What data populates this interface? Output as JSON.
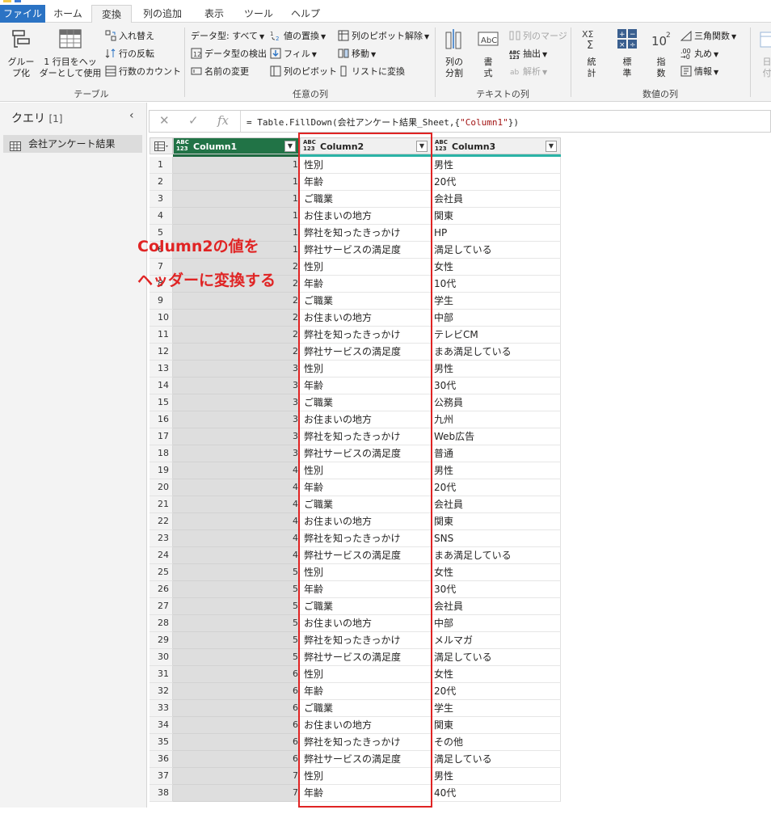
{
  "menu": {
    "tabs": [
      "ファイル",
      "ホーム",
      "変換",
      "列の追加",
      "表示",
      "ツール",
      "ヘルプ"
    ],
    "active_tab": "変換"
  },
  "ribbon": {
    "table": {
      "group_label": "テーブル",
      "group_by": "グルー\nプ化",
      "use_first_row": "1 行目をヘッ\nダーとして使用",
      "transpose": "入れ替え",
      "reverse_rows": "行の反転",
      "count_rows": "行数のカウント"
    },
    "any_column": {
      "group_label": "任意の列",
      "data_type": "データ型: すべて",
      "detect_type": "データ型の検出",
      "rename": "名前の変更",
      "replace_values": "値の置換",
      "fill": "フィル",
      "pivot": "列のピボット",
      "unpivot": "列のピボット解除",
      "move": "移動",
      "to_list": "リストに変換"
    },
    "text_column": {
      "group_label": "テキストの列",
      "split": "列の\n分割",
      "format": "書\n式",
      "merge": "列のマージ",
      "extract": "抽出",
      "parse": "解析"
    },
    "number_column": {
      "group_label": "数値の列",
      "statistics": "統\n計",
      "standard": "標\n準",
      "scientific": "指\n数",
      "trig": "三角関数",
      "rounding": "丸め",
      "information": "情報",
      "date_partial": "日\n付"
    }
  },
  "queries": {
    "title": "クエリ",
    "count": "[1]",
    "items": [
      "会社アンケート結果"
    ]
  },
  "formula": {
    "prefix": "= Table.FillDown(会社アンケート結果_Sheet,{",
    "string": "\"Column1\"",
    "suffix": "})"
  },
  "grid": {
    "columns": [
      {
        "type": "ABC\n123",
        "name": "Column1"
      },
      {
        "type": "ABC\n123",
        "name": "Column2"
      },
      {
        "type": "ABC\n123",
        "name": "Column3"
      }
    ],
    "rows": [
      {
        "n": "1",
        "c1": "1",
        "c2": "性別",
        "c3": "男性"
      },
      {
        "n": "2",
        "c1": "1",
        "c2": "年齢",
        "c3": "20代"
      },
      {
        "n": "3",
        "c1": "1",
        "c2": "ご職業",
        "c3": "会社員"
      },
      {
        "n": "4",
        "c1": "1",
        "c2": "お住まいの地方",
        "c3": "関東"
      },
      {
        "n": "5",
        "c1": "1",
        "c2": "弊社を知ったきっかけ",
        "c3": "HP"
      },
      {
        "n": "6",
        "c1": "1",
        "c2": "弊社サービスの満足度",
        "c3": "満足している"
      },
      {
        "n": "7",
        "c1": "2",
        "c2": "性別",
        "c3": "女性"
      },
      {
        "n": "8",
        "c1": "2",
        "c2": "年齢",
        "c3": "10代"
      },
      {
        "n": "9",
        "c1": "2",
        "c2": "ご職業",
        "c3": "学生"
      },
      {
        "n": "10",
        "c1": "2",
        "c2": "お住まいの地方",
        "c3": "中部"
      },
      {
        "n": "11",
        "c1": "2",
        "c2": "弊社を知ったきっかけ",
        "c3": "テレビCM"
      },
      {
        "n": "12",
        "c1": "2",
        "c2": "弊社サービスの満足度",
        "c3": "まあ満足している"
      },
      {
        "n": "13",
        "c1": "3",
        "c2": "性別",
        "c3": "男性"
      },
      {
        "n": "14",
        "c1": "3",
        "c2": "年齢",
        "c3": "30代"
      },
      {
        "n": "15",
        "c1": "3",
        "c2": "ご職業",
        "c3": "公務員"
      },
      {
        "n": "16",
        "c1": "3",
        "c2": "お住まいの地方",
        "c3": "九州"
      },
      {
        "n": "17",
        "c1": "3",
        "c2": "弊社を知ったきっかけ",
        "c3": "Web広告"
      },
      {
        "n": "18",
        "c1": "3",
        "c2": "弊社サービスの満足度",
        "c3": "普通"
      },
      {
        "n": "19",
        "c1": "4",
        "c2": "性別",
        "c3": "男性"
      },
      {
        "n": "20",
        "c1": "4",
        "c2": "年齢",
        "c3": "20代"
      },
      {
        "n": "21",
        "c1": "4",
        "c2": "ご職業",
        "c3": "会社員"
      },
      {
        "n": "22",
        "c1": "4",
        "c2": "お住まいの地方",
        "c3": "関東"
      },
      {
        "n": "23",
        "c1": "4",
        "c2": "弊社を知ったきっかけ",
        "c3": "SNS"
      },
      {
        "n": "24",
        "c1": "4",
        "c2": "弊社サービスの満足度",
        "c3": "まあ満足している"
      },
      {
        "n": "25",
        "c1": "5",
        "c2": "性別",
        "c3": "女性"
      },
      {
        "n": "26",
        "c1": "5",
        "c2": "年齢",
        "c3": "30代"
      },
      {
        "n": "27",
        "c1": "5",
        "c2": "ご職業",
        "c3": "会社員"
      },
      {
        "n": "28",
        "c1": "5",
        "c2": "お住まいの地方",
        "c3": "中部"
      },
      {
        "n": "29",
        "c1": "5",
        "c2": "弊社を知ったきっかけ",
        "c3": "メルマガ"
      },
      {
        "n": "30",
        "c1": "5",
        "c2": "弊社サービスの満足度",
        "c3": "満足している"
      },
      {
        "n": "31",
        "c1": "6",
        "c2": "性別",
        "c3": "女性"
      },
      {
        "n": "32",
        "c1": "6",
        "c2": "年齢",
        "c3": "20代"
      },
      {
        "n": "33",
        "c1": "6",
        "c2": "ご職業",
        "c3": "学生"
      },
      {
        "n": "34",
        "c1": "6",
        "c2": "お住まいの地方",
        "c3": "関東"
      },
      {
        "n": "35",
        "c1": "6",
        "c2": "弊社を知ったきっかけ",
        "c3": "その他"
      },
      {
        "n": "36",
        "c1": "6",
        "c2": "弊社サービスの満足度",
        "c3": "満足している"
      },
      {
        "n": "37",
        "c1": "7",
        "c2": "性別",
        "c3": "男性"
      },
      {
        "n": "38",
        "c1": "7",
        "c2": "年齢",
        "c3": "40代"
      }
    ]
  },
  "annotation": {
    "line1": "Column2の値を",
    "line2": "ヘッダーに変換する"
  },
  "colors": {
    "file_tab": "#2b73c4",
    "column1_header": "#217346",
    "quality_bar": "#2bb3a6",
    "annotation": "#e02424"
  }
}
